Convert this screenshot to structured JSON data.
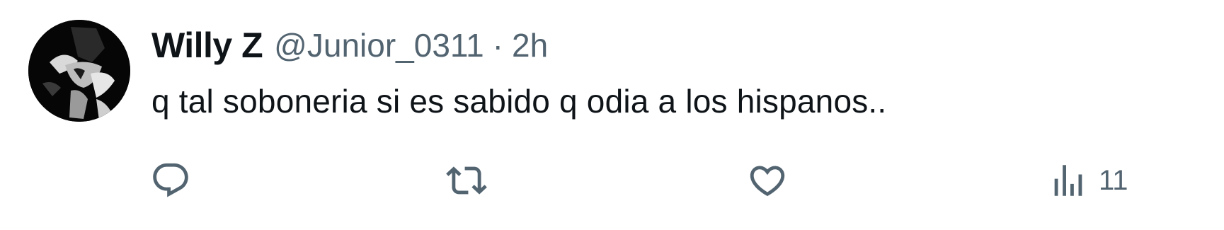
{
  "tweet": {
    "display_name": "Willy Z",
    "handle": "@Junior_0311",
    "separator": "·",
    "time": "2h",
    "text": "q tal soboneria si es sabido q odia a los hispanos..",
    "avatar_icon": "user-avatar-photo"
  },
  "actions": {
    "reply": {
      "icon": "reply-icon",
      "count": ""
    },
    "retweet": {
      "icon": "retweet-icon",
      "count": ""
    },
    "like": {
      "icon": "heart-icon",
      "count": ""
    },
    "views": {
      "icon": "views-chart-icon",
      "count": "11"
    }
  },
  "colors": {
    "text_primary": "#0f1419",
    "text_secondary": "#536471",
    "background": "#ffffff"
  }
}
